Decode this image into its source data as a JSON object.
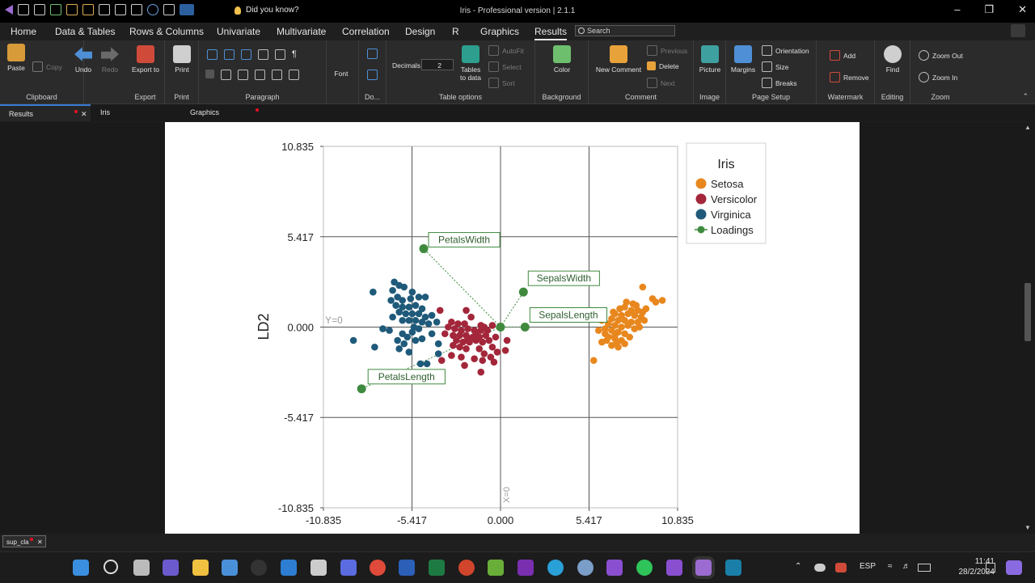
{
  "app": {
    "title": "Iris - Professional version | 2.1.1",
    "did_you_know": "Did you know?",
    "search_placeholder": "Search"
  },
  "menu": [
    "Home",
    "Data & Tables",
    "Rows & Columns",
    "Univariate",
    "Multivariate",
    "Correlation",
    "Design",
    "R",
    "Graphics",
    "Results"
  ],
  "ribbon": {
    "clipboard": {
      "paste": "Paste",
      "copy": "Copy",
      "label": "Clipboard"
    },
    "undo": "Undo",
    "redo": "Redo",
    "export": {
      "btn": "Export to",
      "label": "Export"
    },
    "print": {
      "btn": "Print",
      "label": "Print"
    },
    "paragraph": {
      "label": "Paragraph"
    },
    "font": {
      "btn": "Font"
    },
    "doc": {
      "label": "Do..."
    },
    "table_options": {
      "decimals_label": "Decimals",
      "decimals_value": "2",
      "tables_to_data": "Tables to data",
      "autofit": "AutoFit",
      "select": "Select",
      "sort": "Sort",
      "label": "Table options"
    },
    "background": {
      "btn": "Color",
      "label": "Background"
    },
    "comment": {
      "new": "New Comment",
      "previous": "Previous",
      "delete": "Delete",
      "next": "Next",
      "label": "Comment"
    },
    "image": {
      "btn": "Picture",
      "label": "Image"
    },
    "page_setup": {
      "margins": "Margins",
      "orientation": "Orientation",
      "size": "Size",
      "breaks": "Breaks",
      "label": "Page Setup"
    },
    "watermark": {
      "add": "Add",
      "remove": "Remove",
      "label": "Watermark"
    },
    "editing": {
      "btn": "Find",
      "label": "Editing"
    },
    "zoom": {
      "out": "Zoom Out",
      "in": "Zoom In",
      "label": "Zoom"
    }
  },
  "tabs": [
    {
      "label": "Results",
      "modified": true,
      "active": true
    },
    {
      "label": "Iris",
      "modified": false,
      "active": false
    },
    {
      "label": "Graphics",
      "modified": true,
      "active": false
    }
  ],
  "output_tab": "sup_cla",
  "taskbar": {
    "lang": "ESP",
    "time": "11:41",
    "date": "28/2/2024"
  },
  "chart_data": {
    "type": "scatter",
    "title": "",
    "xlabel": "",
    "ylabel": "LD2",
    "xlim": [
      -10.835,
      10.835
    ],
    "ylim": [
      -10.835,
      10.835
    ],
    "xticks": [
      "-10.835",
      "-5.417",
      "0.000",
      "5.417",
      "10.835"
    ],
    "yticks": [
      "10.835",
      "5.417",
      "0.000",
      "-5.417",
      "-10.835"
    ],
    "grid": true,
    "ref_labels": {
      "y0": "Y=0",
      "x0": "X=0"
    },
    "legend": {
      "title": "Iris",
      "position": "top-right"
    },
    "series": [
      {
        "name": "Setosa",
        "color": "#e8871e",
        "points": [
          [
            8.7,
            2.4
          ],
          [
            9.3,
            1.7
          ],
          [
            9.5,
            1.5
          ],
          [
            9.9,
            1.6
          ],
          [
            8.1,
            1.4
          ],
          [
            7.6,
            1.2
          ],
          [
            8.0,
            1.0
          ],
          [
            8.4,
            1.0
          ],
          [
            7.0,
            0.8
          ],
          [
            7.4,
            0.7
          ],
          [
            7.8,
            0.8
          ],
          [
            8.2,
            0.7
          ],
          [
            8.6,
            0.6
          ],
          [
            6.8,
            0.5
          ],
          [
            7.2,
            0.4
          ],
          [
            7.6,
            0.4
          ],
          [
            8.0,
            0.3
          ],
          [
            8.4,
            0.3
          ],
          [
            8.8,
            0.4
          ],
          [
            6.2,
            0.4
          ],
          [
            6.6,
            0.2
          ],
          [
            7.0,
            0.1
          ],
          [
            7.4,
            0.0
          ],
          [
            7.8,
            0.1
          ],
          [
            8.2,
            -0.1
          ],
          [
            6.4,
            -0.1
          ],
          [
            6.8,
            -0.2
          ],
          [
            7.2,
            -0.3
          ],
          [
            7.6,
            -0.4
          ],
          [
            6.6,
            -0.6
          ],
          [
            7.0,
            -0.7
          ],
          [
            7.4,
            -0.8
          ],
          [
            6.2,
            -0.9
          ],
          [
            6.8,
            -1.1
          ],
          [
            7.2,
            -1.2
          ],
          [
            7.6,
            -1.0
          ],
          [
            5.7,
            -2.0
          ],
          [
            8.3,
            1.3
          ],
          [
            7.3,
            1.1
          ],
          [
            8.7,
            0.9
          ],
          [
            6.4,
            -0.4
          ],
          [
            7.9,
            -0.6
          ],
          [
            6.0,
            -0.2
          ],
          [
            8.5,
            0.0
          ],
          [
            7.0,
            -0.5
          ],
          [
            7.1,
            -1.0
          ],
          [
            6.9,
            0.9
          ],
          [
            7.7,
            1.5
          ],
          [
            8.9,
            1.1
          ],
          [
            6.5,
            -0.8
          ]
        ]
      },
      {
        "name": "Versicolor",
        "color": "#a3263a",
        "points": [
          [
            -3.7,
            1.0
          ],
          [
            -2.1,
            1.0
          ],
          [
            -1.8,
            0.6
          ],
          [
            -3.0,
            0.3
          ],
          [
            -2.6,
            0.2
          ],
          [
            -2.2,
            0.2
          ],
          [
            -1.2,
            0.1
          ],
          [
            -1.0,
            0.0
          ],
          [
            -3.2,
            0.0
          ],
          [
            -2.8,
            -0.1
          ],
          [
            -2.4,
            -0.2
          ],
          [
            -2.0,
            -0.1
          ],
          [
            -1.6,
            -0.2
          ],
          [
            -1.2,
            -0.2
          ],
          [
            -0.8,
            -0.2
          ],
          [
            -3.4,
            -0.4
          ],
          [
            -2.9,
            -0.5
          ],
          [
            -2.5,
            -0.5
          ],
          [
            -2.1,
            -0.5
          ],
          [
            -1.7,
            -0.6
          ],
          [
            -1.3,
            -0.6
          ],
          [
            -0.9,
            -0.5
          ],
          [
            -0.5,
            0.1
          ],
          [
            -2.7,
            -0.8
          ],
          [
            -2.3,
            -0.9
          ],
          [
            -1.9,
            -0.9
          ],
          [
            -1.5,
            -0.8
          ],
          [
            -1.1,
            -0.9
          ],
          [
            -0.7,
            -0.8
          ],
          [
            -0.3,
            -0.6
          ],
          [
            0.4,
            -0.8
          ],
          [
            -2.5,
            -1.2
          ],
          [
            -2.1,
            -1.3
          ],
          [
            -1.3,
            -1.3
          ],
          [
            -1.0,
            -1.6
          ],
          [
            -0.6,
            -1.8
          ],
          [
            -0.2,
            -1.5
          ],
          [
            0.3,
            -1.4
          ],
          [
            -3.0,
            -1.7
          ],
          [
            -2.4,
            -1.8
          ],
          [
            -1.6,
            -1.9
          ],
          [
            -1.1,
            -2.0
          ],
          [
            -0.4,
            -2.1
          ],
          [
            -3.6,
            -2.0
          ],
          [
            -1.2,
            -2.7
          ],
          [
            -2.0,
            -0.7
          ],
          [
            -2.9,
            -1.1
          ],
          [
            -0.5,
            -1.2
          ],
          [
            -1.5,
            -0.4
          ],
          [
            -2.2,
            -2.3
          ]
        ]
      },
      {
        "name": "Virginica",
        "color": "#1f5a7a",
        "points": [
          [
            -6.5,
            2.7
          ],
          [
            -6.2,
            2.5
          ],
          [
            -5.9,
            2.4
          ],
          [
            -5.4,
            2.1
          ],
          [
            -7.8,
            2.1
          ],
          [
            -6.6,
            2.2
          ],
          [
            -6.3,
            1.8
          ],
          [
            -6.0,
            1.6
          ],
          [
            -6.7,
            1.6
          ],
          [
            -5.5,
            1.7
          ],
          [
            -5.0,
            1.8
          ],
          [
            -4.6,
            1.8
          ],
          [
            -6.4,
            1.3
          ],
          [
            -6.0,
            1.2
          ],
          [
            -5.6,
            1.2
          ],
          [
            -5.2,
            1.3
          ],
          [
            -4.8,
            1.1
          ],
          [
            -6.2,
            0.9
          ],
          [
            -5.8,
            0.8
          ],
          [
            -5.4,
            0.8
          ],
          [
            -5.0,
            0.8
          ],
          [
            -4.6,
            0.6
          ],
          [
            -4.2,
            0.7
          ],
          [
            -6.6,
            0.6
          ],
          [
            -6.0,
            0.4
          ],
          [
            -5.6,
            0.4
          ],
          [
            -5.2,
            0.4
          ],
          [
            -4.8,
            0.3
          ],
          [
            -4.4,
            0.2
          ],
          [
            -3.9,
            0.3
          ],
          [
            -7.2,
            -0.1
          ],
          [
            -6.8,
            -0.2
          ],
          [
            -5.0,
            -0.1
          ],
          [
            -5.4,
            -0.3
          ],
          [
            -6.0,
            -0.4
          ],
          [
            -5.7,
            -0.6
          ],
          [
            -5.2,
            -0.8
          ],
          [
            -6.3,
            -0.8
          ],
          [
            -4.8,
            -0.7
          ],
          [
            -5.9,
            -1.0
          ],
          [
            -6.2,
            -1.3
          ],
          [
            -7.7,
            -1.2
          ],
          [
            -9.0,
            -0.8
          ],
          [
            -5.6,
            -1.5
          ],
          [
            -3.8,
            -1.0
          ],
          [
            -3.8,
            -1.6
          ],
          [
            -4.5,
            -2.2
          ],
          [
            -4.9,
            -2.2
          ],
          [
            -5.3,
            0.0
          ],
          [
            -4.2,
            -0.4
          ]
        ]
      }
    ],
    "loadings": {
      "name": "Loadings",
      "color": "#3f8a3f",
      "vectors": [
        {
          "name": "PetalsWidth",
          "x": -4.7,
          "y": 4.7
        },
        {
          "name": "SepalsWidth",
          "x": 1.4,
          "y": 2.1
        },
        {
          "name": "SepalsLength",
          "x": 1.5,
          "y": 0.0
        },
        {
          "name": "PetalsLength",
          "x": -8.5,
          "y": -3.7
        }
      ]
    }
  }
}
